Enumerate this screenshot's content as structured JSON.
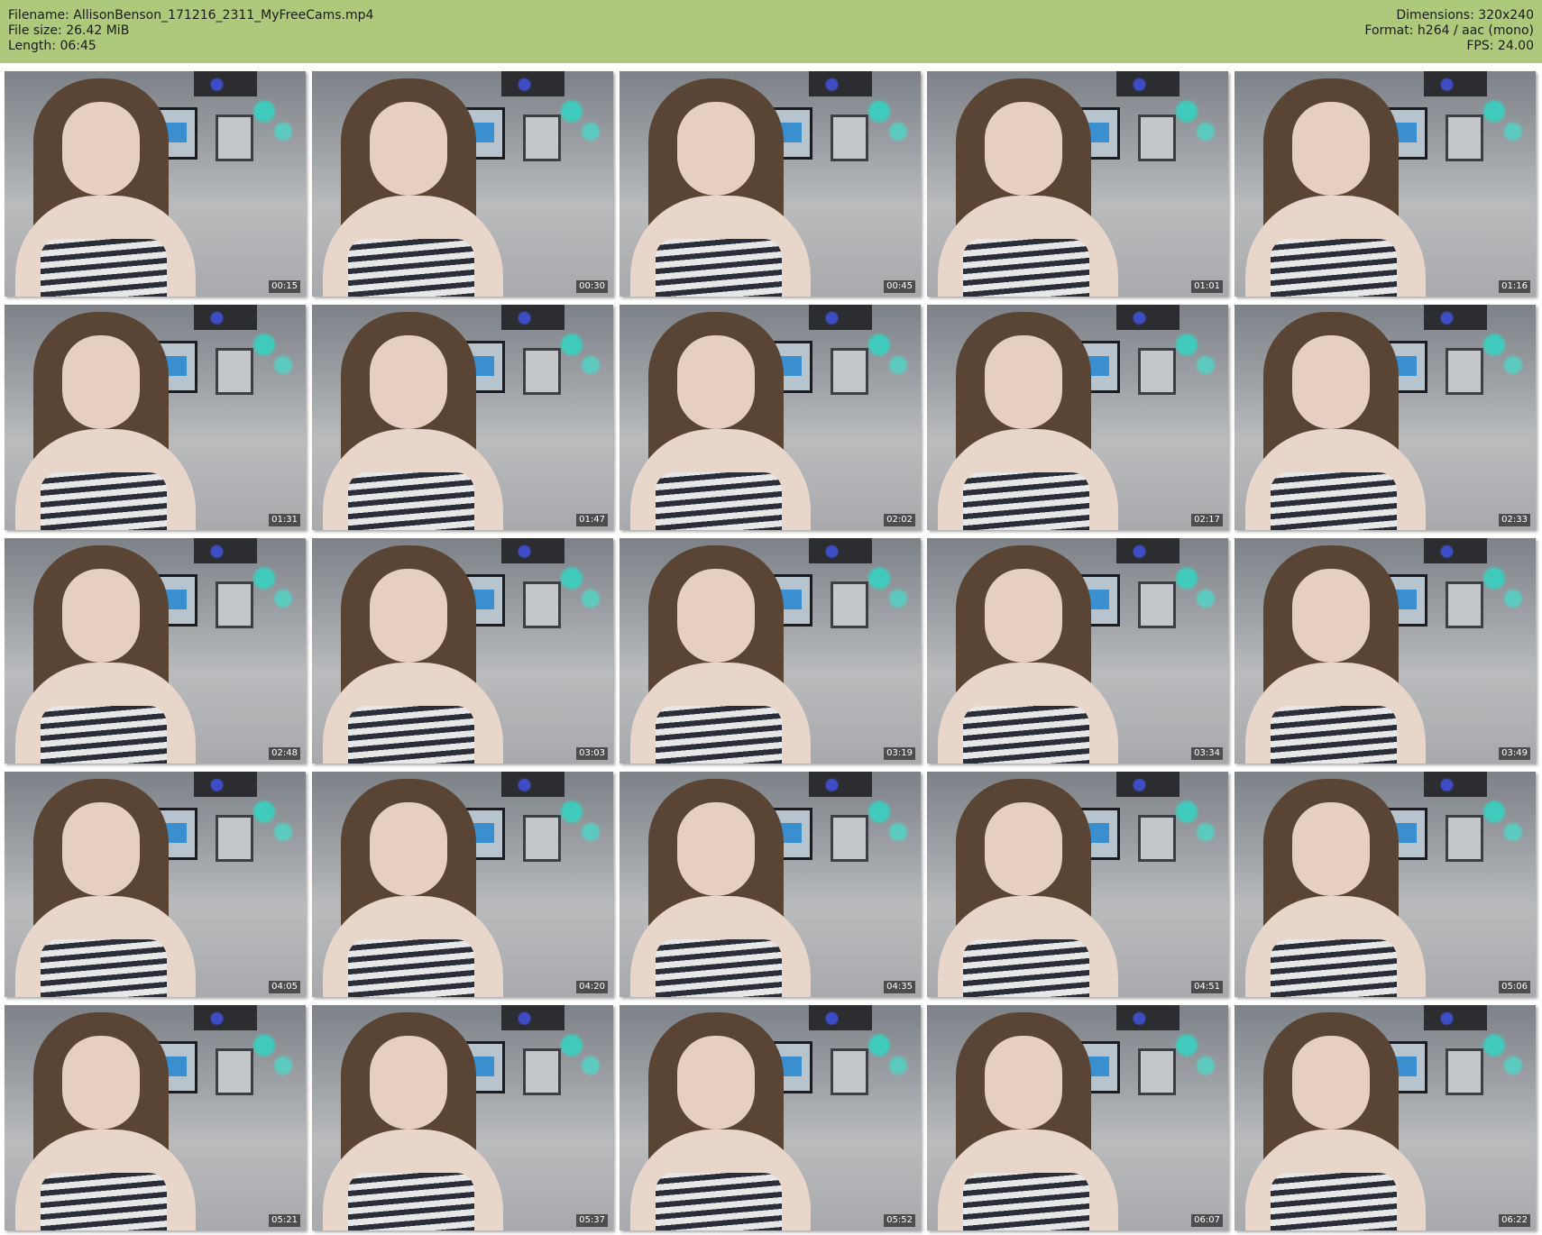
{
  "header": {
    "filename_line": "Filename: AllisonBenson_171216_2311_MyFreeCams.mp4",
    "filesize_line": "File size: 26.42 MiB",
    "length_line": "Length: 06:45",
    "dimensions_line": "Dimensions: 320x240",
    "format_line": "Format: h264 / aac (mono)",
    "fps_line": "FPS: 24.00"
  },
  "colors": {
    "header_bg": "#aec97c",
    "page_bg": "#ffffff"
  },
  "thumbnails": [
    {
      "time": "00:15"
    },
    {
      "time": "00:30"
    },
    {
      "time": "00:45"
    },
    {
      "time": "01:01"
    },
    {
      "time": "01:16"
    },
    {
      "time": "01:31"
    },
    {
      "time": "01:47"
    },
    {
      "time": "02:02"
    },
    {
      "time": "02:17"
    },
    {
      "time": "02:33"
    },
    {
      "time": "02:48"
    },
    {
      "time": "03:03"
    },
    {
      "time": "03:19"
    },
    {
      "time": "03:34"
    },
    {
      "time": "03:49"
    },
    {
      "time": "04:05"
    },
    {
      "time": "04:20"
    },
    {
      "time": "04:35"
    },
    {
      "time": "04:51"
    },
    {
      "time": "05:06"
    },
    {
      "time": "05:21"
    },
    {
      "time": "05:37"
    },
    {
      "time": "05:52"
    },
    {
      "time": "06:07"
    },
    {
      "time": "06:22"
    }
  ]
}
